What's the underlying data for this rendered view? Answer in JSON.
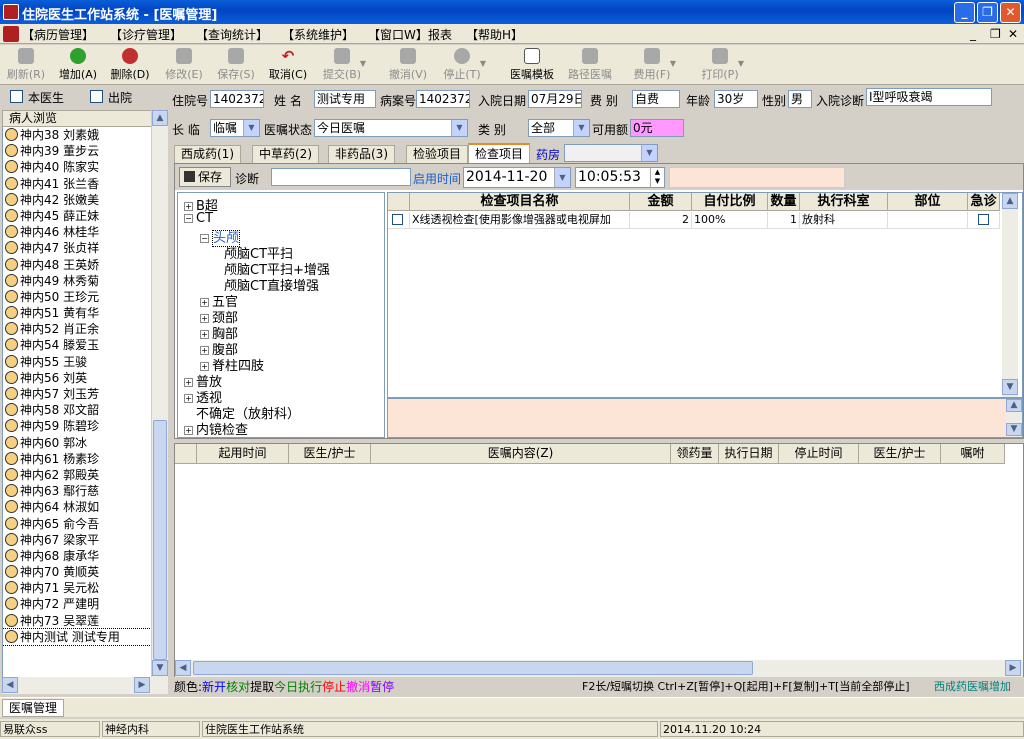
{
  "window": {
    "title": "住院医生工作站系统 - [医嘱管理]"
  },
  "menu": [
    "【病历管理】",
    "【诊疗管理】",
    "【查询统计】",
    "【系统维护】",
    "【窗口W】",
    "报表",
    "【帮助H】"
  ],
  "toolbar": [
    "刷新(R)",
    "增加(A)",
    "删除(D)",
    "修改(E)",
    "保存(S)",
    "取消(C)",
    "提交(B)",
    "撤消(V)",
    "停止(T)",
    "医嘱模板",
    "路径医嘱",
    "费用(F)",
    "打印(P)"
  ],
  "left": {
    "chk_doctor": "本医生",
    "chk_discharged": "出院",
    "list_header": "病人浏览",
    "patients": [
      "神内38 刘素娥",
      "神内39 董步云",
      "神内40 陈家实",
      "神内41 张兰香",
      "神内42 张嫩美",
      "神内45 薛正妹",
      "神内46 林桂华",
      "神内47 张贞祥",
      "神内48 王英娇",
      "神内49 林秀菊",
      "神内50 王珍元",
      "神内51 黄有华",
      "神内52 肖正余",
      "神内54 滕爱玉",
      "神内55 王骏",
      "神内56 刘英",
      "神内57 刘玉芳",
      "神内58 邓文韶",
      "神内59 陈碧珍",
      "神内60 郭冰",
      "神内61 杨素珍",
      "神内62 郭殿英",
      "神内63 鄢行慈",
      "神内64 林淑如",
      "神内65 俞今吾",
      "神内67 梁家平",
      "神内68 康承华",
      "神内70 黄顺英",
      "神内71 吴元松",
      "神内72 严建明",
      "神内73 吴翠莲",
      "神内测试 测试专用"
    ]
  },
  "form": {
    "inpatient_no_label": "住院号",
    "inpatient_no": "1402372",
    "name_label": "姓  名",
    "name": "测试专用",
    "record_no_label": "病案号",
    "record_no": "1402372",
    "admit_date_label": "入院日期",
    "admit_date": "07月29日",
    "fee_label": "费  别",
    "fee": "自费",
    "age_label": "年龄",
    "age": "30岁",
    "sex_label": "性别",
    "sex": "男",
    "diag_label": "入院诊断",
    "diag": "I型呼吸衰竭",
    "long_label": "长  临",
    "long": "临嘱",
    "status_label": "医嘱状态",
    "status": "今日医嘱",
    "class_label": "类    别",
    "class": "全部",
    "balance_label": "可用额",
    "balance": "0元"
  },
  "tabs": [
    "西成药(1)",
    "中草药(2)",
    "非药品(3)",
    "检验项目",
    "检查项目",
    "药房"
  ],
  "order": {
    "save": "保存",
    "diag_label": "诊断",
    "diag": "",
    "start_label": "启用时间",
    "date": "2014-11-20",
    "time": "10:05:53"
  },
  "tree": [
    {
      "label": "B超",
      "pm": "+"
    },
    {
      "label": "CT",
      "pm": "-"
    },
    {
      "label": "头颅",
      "pm": "-"
    },
    {
      "label": "颅脑CT平扫",
      "pm": ""
    },
    {
      "label": "颅脑CT平扫+增强",
      "pm": ""
    },
    {
      "label": "颅脑CT直接增强",
      "pm": ""
    },
    {
      "label": "五官",
      "pm": "+"
    },
    {
      "label": "颈部",
      "pm": "+"
    },
    {
      "label": "胸部",
      "pm": "+"
    },
    {
      "label": "腹部",
      "pm": "+"
    },
    {
      "label": "脊柱四肢",
      "pm": "+"
    },
    {
      "label": "普放",
      "pm": "+"
    },
    {
      "label": "透视",
      "pm": "+"
    },
    {
      "label": "不确定（放射科）",
      "pm": ""
    },
    {
      "label": "内镜检查",
      "pm": "+"
    }
  ],
  "grid1": {
    "headers": [
      "检查项目名称",
      "金额",
      "自付比例",
      "数量",
      "执行科室",
      "部位",
      "急诊"
    ],
    "row": {
      "name": "X线透视检查[使用影像增强器或电视屏加",
      "amount": "2",
      "ratio": "100%",
      "qty": "1",
      "dept": "放射科",
      "part": ""
    }
  },
  "grid2": {
    "headers": [
      "起用时间",
      "医生/护士",
      "医嘱内容(Z)",
      "领药量",
      "执行日期",
      "停止时间",
      "医生/护士",
      "嘱咐"
    ]
  },
  "legend": {
    "prefix": "颜色:",
    "new": "新开",
    "check": "核对",
    "pick": "提取",
    "today": "今日执行",
    "stop": "停止",
    "cancel": "撤消",
    "pause": "暂停",
    "shortcuts": "F2长/短嘱切换 Ctrl+Z[暂停]+Q[起用]+F[复制]+T[当前全部停止]",
    "mode": "西成药医嘱增加"
  },
  "mdi_tab": "医嘱管理",
  "statusbar": [
    "易联众ss",
    "神经内科",
    "住院医生工作站系统",
    "",
    "2014.11.20 10:24"
  ],
  "colors": {
    "new": "#0000ff",
    "check": "#008000",
    "today": "#008000",
    "stop": "#ff0000",
    "cancel": "#ff00ff",
    "pause": "#8000ff",
    "mode": "#008080"
  }
}
